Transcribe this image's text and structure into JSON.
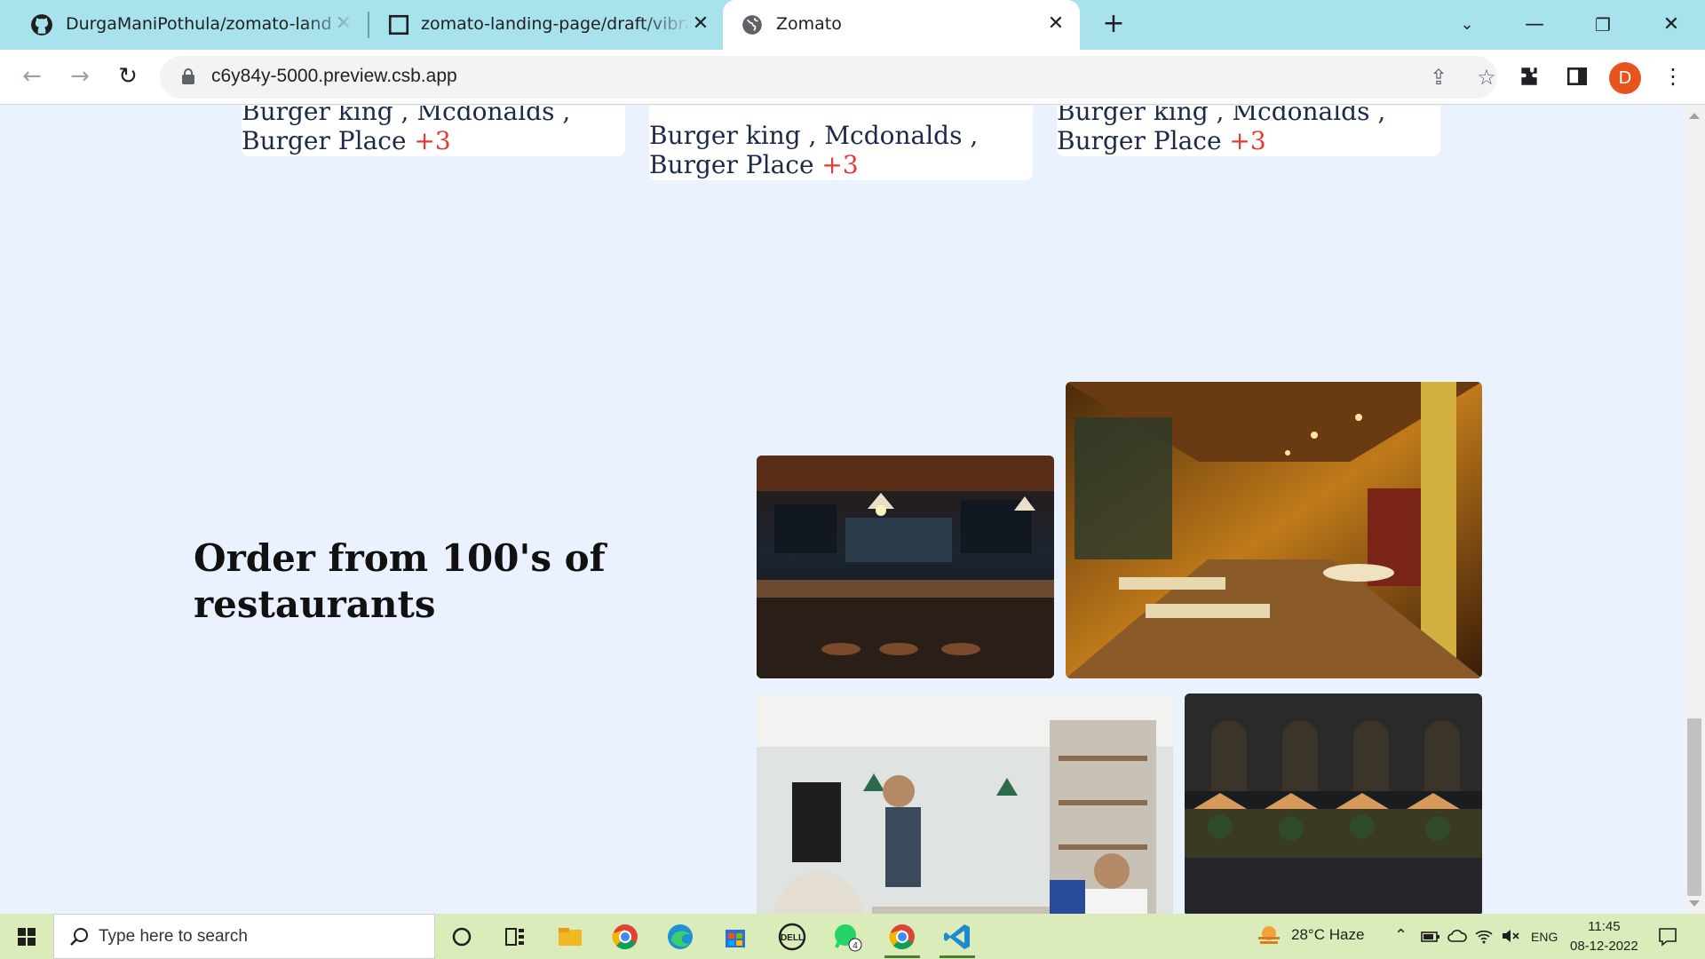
{
  "browser": {
    "tabs": [
      {
        "title": "DurgaManiPothula/zomato-landi",
        "favicon": "github-icon"
      },
      {
        "title": "zomato-landing-page/draft/vibra",
        "favicon": "codesandbox-icon"
      },
      {
        "title": "Zomato",
        "favicon": "globe-icon",
        "active": true
      }
    ],
    "url": "c6y84y-5000.preview.csb.app",
    "profile_initial": "D",
    "profile_color": "#e8541e"
  },
  "page": {
    "cards": [
      {
        "text": "Burger king , Mcdonalds , Burger Place",
        "more": "+3"
      },
      {
        "text": "Burger king , Mcdonalds , Burger Place",
        "more": "+3"
      },
      {
        "text": "Burger king , Mcdonalds , Burger Place",
        "more": "+3"
      }
    ],
    "card_line1": "Burger king , Mcdonalds ,",
    "card_line2": "Burger Place",
    "heading": "Order from 100's of restaurants",
    "photos": [
      "bar-counter-photo",
      "restaurant-interior-photo",
      "busy-cafe-photo",
      "outdoor-dining-photo"
    ],
    "accent": "#e53935",
    "background": "#eaf1ff"
  },
  "taskbar": {
    "search_placeholder": "Type here to search",
    "weather": "28°C  Haze",
    "language": "ENG",
    "time": "11:45",
    "date": "08-12-2022",
    "whatsapp_badge": "4"
  }
}
